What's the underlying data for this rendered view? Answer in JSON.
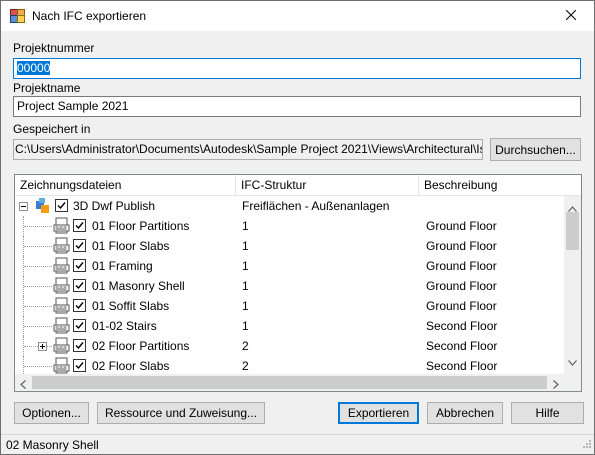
{
  "window": {
    "title": "Nach IFC exportieren",
    "title_icon": "ifc-export-icon",
    "close_icon": "close-icon"
  },
  "fields": {
    "projektnummer_label": "Projektnummer",
    "projektnummer_value": "00000",
    "projektname_label": "Projektname",
    "projektname_value": "Project Sample 2021",
    "gespeichert_label": "Gespeichert in",
    "gespeichert_value": "C:\\Users\\Administrator\\Documents\\Autodesk\\Sample Project 2021\\Views\\Architectural\\Isometric",
    "browse_label": "Durchsuchen..."
  },
  "table": {
    "columns": [
      "Zeichnungsdateien",
      "IFC-Struktur",
      "Beschreibung"
    ],
    "root": {
      "name": "3D Dwf Publish",
      "ifc": "Freiflächen - Außenanlagen",
      "desc": "",
      "checked": true
    },
    "rows": [
      {
        "name": "01 Floor Partitions",
        "ifc": "1",
        "desc": "Ground Floor",
        "checked": true,
        "expander": false
      },
      {
        "name": "01 Floor Slabs",
        "ifc": "1",
        "desc": "Ground Floor",
        "checked": true,
        "expander": false
      },
      {
        "name": "01 Framing",
        "ifc": "1",
        "desc": "Ground Floor",
        "checked": true,
        "expander": false
      },
      {
        "name": "01 Masonry Shell",
        "ifc": "1",
        "desc": "Ground Floor",
        "checked": true,
        "expander": false
      },
      {
        "name": "01 Soffit Slabs",
        "ifc": "1",
        "desc": "Ground Floor",
        "checked": true,
        "expander": false
      },
      {
        "name": "01-02 Stairs",
        "ifc": "1",
        "desc": "Second Floor",
        "checked": true,
        "expander": false
      },
      {
        "name": "02 Floor Partitions",
        "ifc": "2",
        "desc": "Second Floor",
        "checked": true,
        "expander": true
      },
      {
        "name": "02 Floor Slabs",
        "ifc": "2",
        "desc": "Second Floor",
        "checked": true,
        "expander": false
      }
    ]
  },
  "buttons": {
    "optionen": "Optionen...",
    "ressource": "Ressource und Zuweisung...",
    "exportieren": "Exportieren",
    "abbrechen": "Abbrechen",
    "hilfe": "Hilfe"
  },
  "status": {
    "text": "02 Masonry Shell"
  },
  "colors": {
    "accent": "#0078d7",
    "window_bg": "#f0f0f0"
  }
}
